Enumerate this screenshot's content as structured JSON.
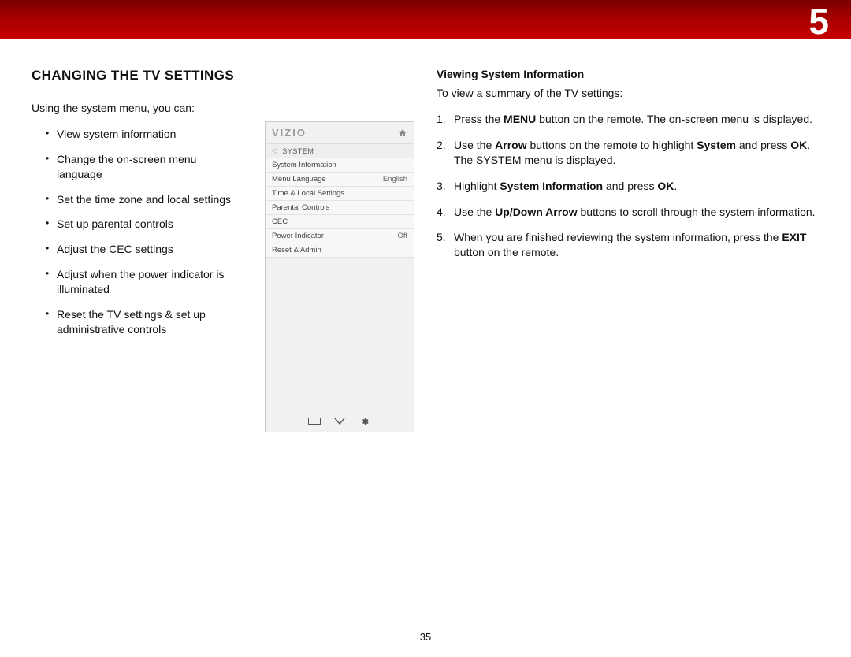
{
  "banner": {
    "chapter_number": "5"
  },
  "page_number": "35",
  "left": {
    "heading": "CHANGING THE TV SETTINGS",
    "intro": "Using the system menu, you can:",
    "bullets": [
      "View system information",
      "Change the on-screen menu language",
      "Set the time zone and local settings",
      "Set up parental controls",
      "Adjust the CEC settings",
      "Adjust when the power indicator is illuminated",
      "Reset the TV settings & set up administrative controls"
    ]
  },
  "osd": {
    "brand": "VIZIO",
    "screen_title": "SYSTEM",
    "items": [
      {
        "label": "System Information",
        "value": ""
      },
      {
        "label": "Menu Language",
        "value": "English"
      },
      {
        "label": "Time & Local Settings",
        "value": ""
      },
      {
        "label": "Parental Controls",
        "value": ""
      },
      {
        "label": "CEC",
        "value": ""
      },
      {
        "label": "Power Indicator",
        "value": "Off"
      },
      {
        "label": "Reset & Admin",
        "value": ""
      }
    ]
  },
  "right": {
    "sub_heading": "Viewing System Information",
    "lead": "To view a summary of the TV settings:",
    "steps": [
      {
        "pre": "Press the ",
        "b1": "MENU",
        "post": " button on the remote. The on-screen menu is displayed."
      },
      {
        "pre": "Use the ",
        "b1": "Arrow",
        "mid": " buttons on the remote to highlight ",
        "b2": "System",
        "mid2": " and press ",
        "b3": "OK",
        "post": ". The SYSTEM menu is displayed."
      },
      {
        "pre": "Highlight ",
        "b1": "System Information",
        "mid": " and press ",
        "b2": "OK",
        "post": "."
      },
      {
        "pre": "Use the ",
        "b1": "Up/Down Arrow",
        "post": " buttons to scroll through the system information."
      },
      {
        "pre": "When you are finished reviewing the system information, press the ",
        "b1": "EXIT",
        "post": " button on the remote."
      }
    ]
  }
}
